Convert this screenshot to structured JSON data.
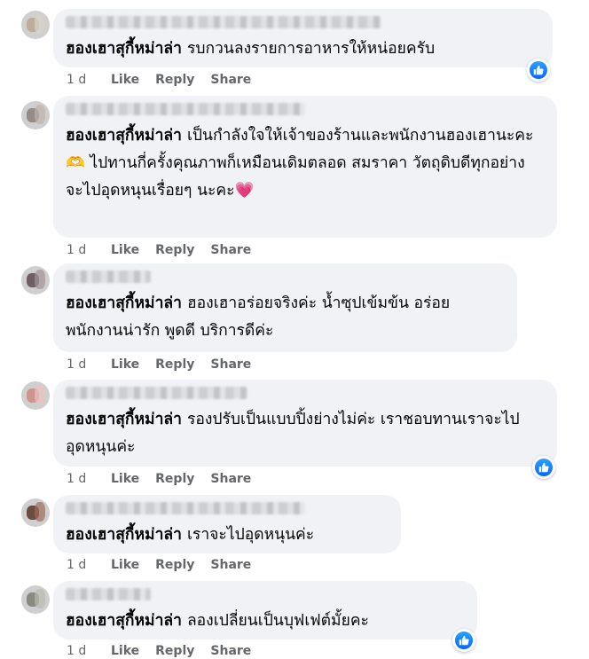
{
  "comments": [
    {
      "page_name": "ฮองเฮาสุกี้หม่าล่า",
      "text": "รบกวนลงรายการอาหารให้หน่อยครับ",
      "time": "1 d",
      "like": "Like",
      "reply": "Reply",
      "share": "Share",
      "has_like_reaction": true,
      "avatar_colors": [
        "#b8a88f",
        "#d9d3c8"
      ]
    },
    {
      "page_name": "ฮองเฮาสุกี้หม่าล่า",
      "text": "เป็นกำลังใจให้เจ้าของร้านและพนักงานฮองเฮานะคะ 🫶 ไปทานกี่ครั้งคุณภาพก็เหมือนเดิมตลอด สมราคา วัตถุดิบดีทุกอย่าง จะไปอุดหนุนเรื่อยๆ นะคะ💗",
      "time": "1 d",
      "like": "Like",
      "reply": "Reply",
      "share": "Share",
      "has_like_reaction": false,
      "avatar_colors": [
        "#8a7f78",
        "#bdb3ab"
      ]
    },
    {
      "page_name": "ฮองเฮาสุกี้หม่าล่า",
      "text": "ฮองเฮาอร่อยจริงค่ะ น้ำซุปเข้มข้น อร่อย พนักงานน่ารัก พูดดี บริการดีค่ะ",
      "time": "1 d",
      "like": "Like",
      "reply": "Reply",
      "share": "Share",
      "has_like_reaction": false,
      "avatar_colors": [
        "#5e4a52",
        "#a3949a"
      ]
    },
    {
      "page_name": "ฮองเฮาสุกี้หม่าล่า",
      "text": "รองปรับเป็นแบบปิ้งย่างไม่ค่ะ เราชอบทานเราจะไปอุดหนุนค่ะ",
      "time": "1 d",
      "like": "Like",
      "reply": "Reply",
      "share": "Share",
      "has_like_reaction": true,
      "avatar_colors": [
        "#d08a84",
        "#e9c3bd"
      ]
    },
    {
      "page_name": "ฮองเฮาสุกี้หม่าล่า",
      "text": "เราจะไปอุดหนุนค่ะ",
      "time": "1 d",
      "like": "Like",
      "reply": "Reply",
      "share": "Share",
      "has_like_reaction": false,
      "avatar_colors": [
        "#5a3526",
        "#9b6d58"
      ]
    },
    {
      "page_name": "ฮองเฮาสุกี้หม่าล่า",
      "text": "ลองเปลี่ยนเป็นบุฟเฟต์มั้ยคะ",
      "time": "1 d",
      "like": "Like",
      "reply": "Reply",
      "share": "Share",
      "has_like_reaction": true,
      "avatar_colors": [
        "#7d7f72",
        "#b9bbae"
      ]
    }
  ],
  "colors": {
    "bubble_bg": "#f0f2f5",
    "meta_text": "#65676b",
    "like_blue": "#0866ff"
  }
}
